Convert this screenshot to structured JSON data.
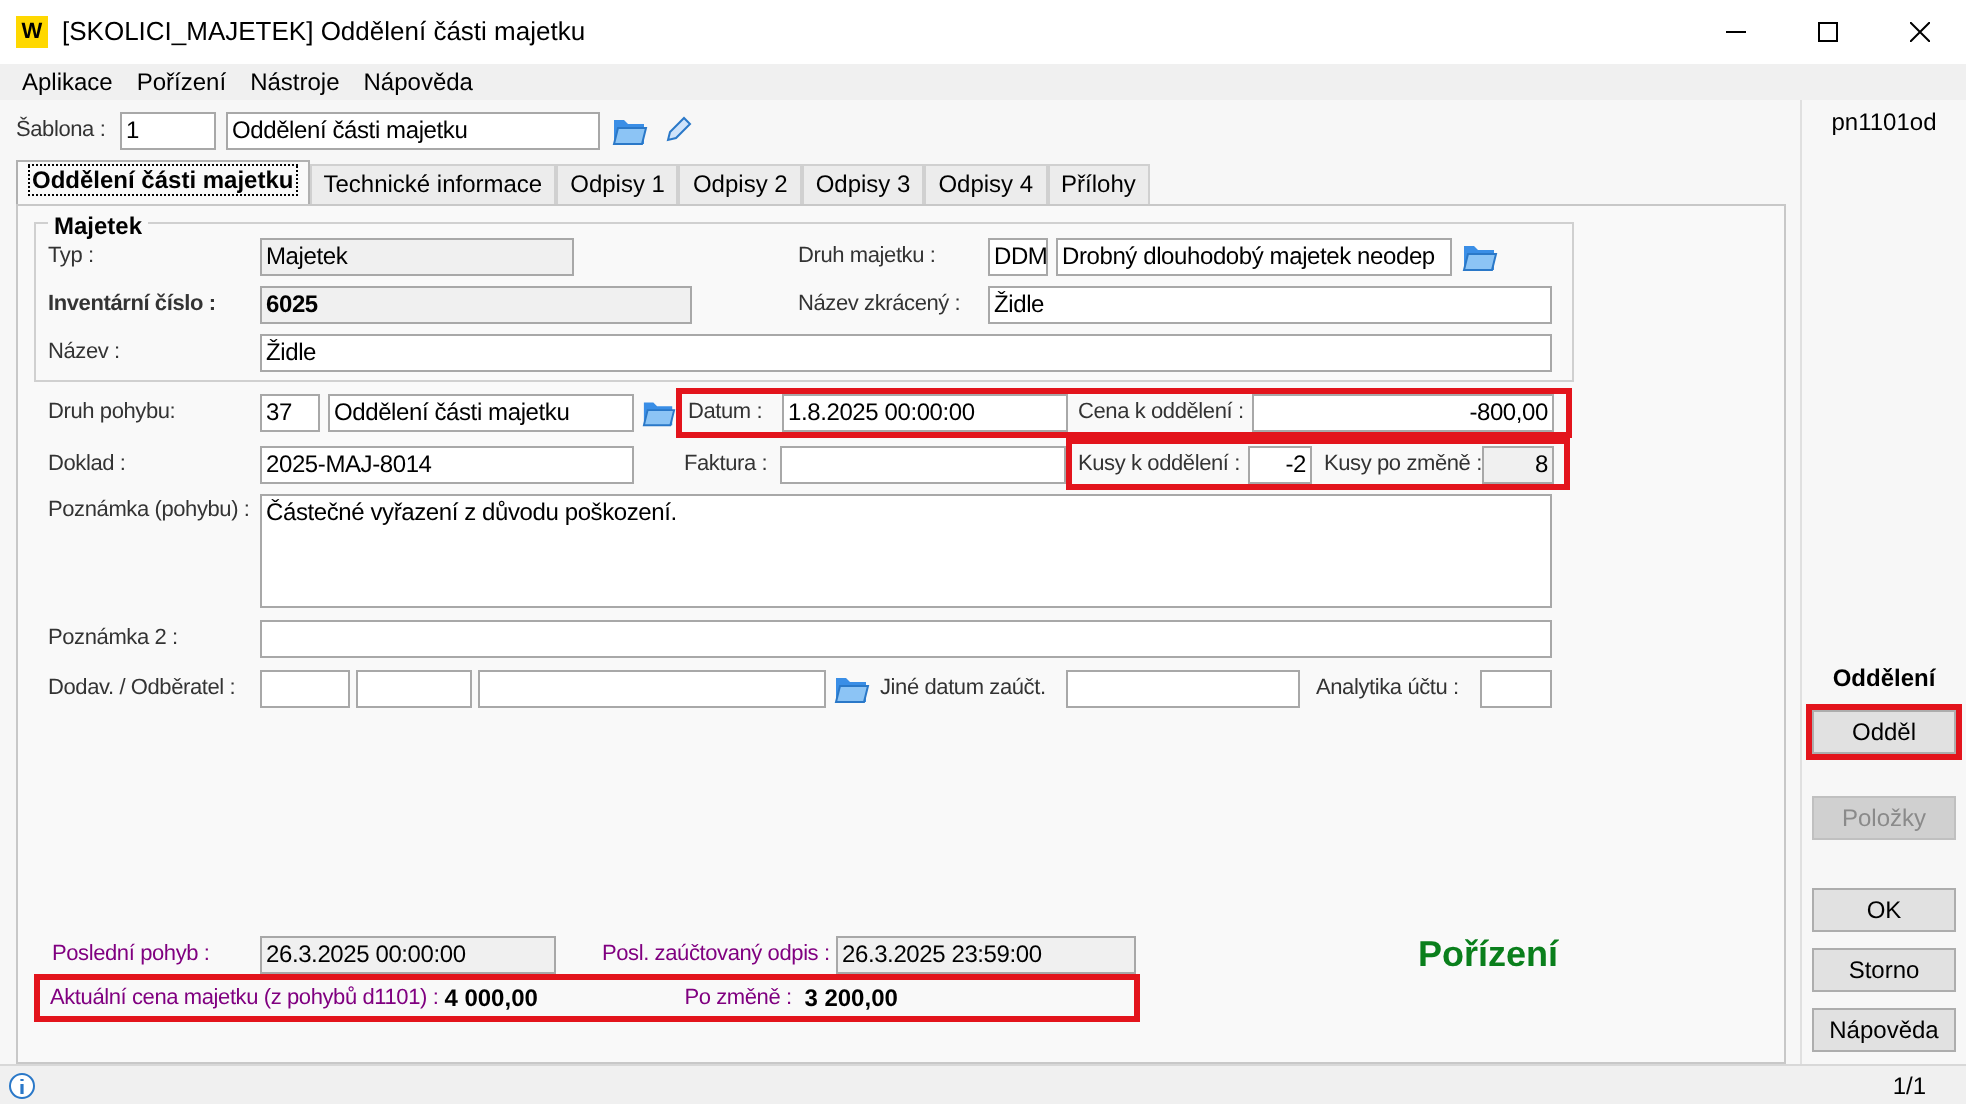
{
  "window": {
    "logo": "W",
    "title": "[SKOLICI_MAJETEK] Oddělení části majetku"
  },
  "menu": [
    "Aplikace",
    "Pořízení",
    "Nástroje",
    "Nápověda"
  ],
  "template": {
    "label": "Šablona :",
    "code": {
      "value": "1",
      "readonly": false
    },
    "name": {
      "value": "Oddělení části majetku",
      "readonly": false
    }
  },
  "tabs": [
    {
      "label": "Oddělení části majetku",
      "selected": true
    },
    {
      "label": "Technické informace",
      "selected": false
    },
    {
      "label": "Odpisy 1",
      "selected": false
    },
    {
      "label": "Odpisy 2",
      "selected": false
    },
    {
      "label": "Odpisy 3",
      "selected": false
    },
    {
      "label": "Odpisy 4",
      "selected": false
    },
    {
      "label": "Přílohy",
      "selected": false
    }
  ],
  "asset": {
    "legend": "Majetek",
    "type_label": "Typ :",
    "type": {
      "value": "Majetek",
      "readonly": true
    },
    "kind_label": "Druh majetku :",
    "kind_code": {
      "value": "DDM",
      "readonly": false
    },
    "kind_name": {
      "value": "Drobný dlouhodobý majetek neodep",
      "readonly": false
    },
    "inventory_label": "Inventární číslo :",
    "inventory": {
      "value": "6025",
      "readonly": true
    },
    "short_label": "Název zkrácený :",
    "short_name": {
      "value": "Židle",
      "readonly": false
    },
    "name_label": "Název :",
    "name": {
      "value": "Židle",
      "readonly": false
    }
  },
  "movement": {
    "type_label": "Druh pohybu:",
    "type_code": {
      "value": "37",
      "readonly": false
    },
    "type_name": {
      "value": "Oddělení části majetku",
      "readonly": false
    },
    "date_price_highlighted": true,
    "date_label": "Datum :",
    "date": {
      "value": "1.8.2025 00:00:00",
      "readonly": false
    },
    "price_label": "Cena k oddělení :",
    "price": {
      "value": "-800,00",
      "readonly": false
    },
    "document_label": "Doklad :",
    "document": {
      "value": "2025-MAJ-8014",
      "readonly": false
    },
    "invoice_label": "Faktura :",
    "invoice": {
      "readonly": false
    },
    "pieces_highlighted": true,
    "pieces_label": "Kusy k oddělení :",
    "pieces": {
      "value": "-2",
      "readonly": false
    },
    "pieces_after_label": "Kusy po změně :",
    "pieces_after": {
      "value": "8",
      "readonly": true
    },
    "note_label": "Poznámka (pohybu) :",
    "note": {
      "value": "Částečné vyřazení z důvodu poškození.",
      "readonly": false
    },
    "note2_label": "Poznámka 2 :",
    "note2": {
      "readonly": false
    },
    "partner_label": "Dodav. / Odběratel :",
    "partner_1": {
      "readonly": false
    },
    "partner_2": {
      "readonly": false
    },
    "partner_3": {
      "readonly": false
    },
    "other_date_label": "Jiné datum zaúčt.",
    "other_date": {
      "readonly": false
    },
    "analytics_label": "Analytika účtu :",
    "analytics": {
      "readonly": false
    }
  },
  "summary": {
    "last_move_label": "Poslední pohyb :",
    "last_move": {
      "value": "26.3.2025 00:00:00",
      "readonly": true
    },
    "last_dep_label": "Posl. zaúčtovaný odpis :",
    "last_dep": {
      "value": "26.3.2025 23:59:00",
      "readonly": true
    },
    "status": "Pořízení",
    "highlighted": true,
    "price_label": "Aktuální cena majetku  (z pohybů d1101) :",
    "price": "4 000,00",
    "after_label": "Po změně  :",
    "after": "3 200,00"
  },
  "side": {
    "code": "pn1101od",
    "section": "Oddělení",
    "buttons": [
      {
        "label": "Odděl",
        "disabled": false,
        "highlighted": true
      },
      {
        "label": "Položky",
        "disabled": true,
        "highlighted": false
      },
      {
        "label": "OK",
        "disabled": false,
        "highlighted": false
      },
      {
        "label": "Storno",
        "disabled": false,
        "highlighted": false
      },
      {
        "label": "Nápověda",
        "disabled": false,
        "highlighted": false
      }
    ]
  },
  "status_bar": {
    "page": "1/1"
  }
}
